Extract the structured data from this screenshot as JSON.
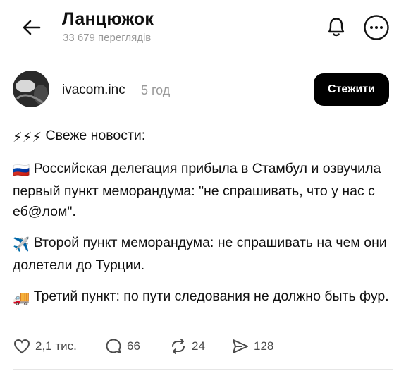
{
  "header": {
    "back_icon": "arrow-left-icon",
    "title": "Ланцюжок",
    "subtitle": "33 679 переглядів",
    "bell_icon": "bell-icon",
    "more_icon": "more-icon"
  },
  "post": {
    "author": "ivacom.inc",
    "time": "5 год",
    "follow_label": "Стежити",
    "paragraphs": [
      {
        "emoji": "⚡⚡⚡",
        "text": " Свеже новости:"
      },
      {
        "emoji": "🇷🇺",
        "text": " Российская делегация прибыла в  Стамбул и озвучила первый пункт меморандума: \"не спрашивать, что у нас с еб@лом\"."
      },
      {
        "emoji": "✈️",
        "text": " Второй пункт меморандума: не спрашивать на чем они долетели до Турции."
      },
      {
        "emoji": "🚚",
        "text": " Третий пункт: по пути следования не должно быть фур."
      }
    ]
  },
  "actions": {
    "likes": "2,1 тис.",
    "comments": "66",
    "reposts": "24",
    "shares": "128"
  },
  "colors": {
    "accent": "#000000",
    "muted": "#9a9a9a"
  }
}
